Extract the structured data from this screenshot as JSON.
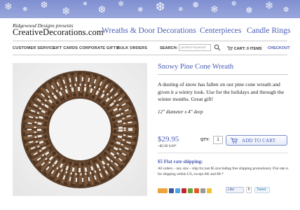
{
  "banner": {
    "color": "#8e9bd6"
  },
  "brand": {
    "tagline": "Ridgewood Designs presents",
    "name": "CreativeDecorations.com"
  },
  "main_nav": [
    {
      "label": "Wreaths & Door Decorations"
    },
    {
      "label": "Centerpieces"
    },
    {
      "label": "Candle Rings"
    }
  ],
  "sub_nav": [
    {
      "label": "CUSTOMER SERVICE"
    },
    {
      "label": "GIFT CARDS"
    },
    {
      "label": "CORPORATE GIFTS"
    },
    {
      "label": "BULK ORDERS"
    }
  ],
  "search": {
    "label": "SEARCH:",
    "placeholder": "product keyword",
    "icon": "search-icon"
  },
  "cart": {
    "label": "CART: 0 ITEMS",
    "checkout": "CHECKOUT",
    "icon": "cart-icon"
  },
  "product": {
    "title": "Snowy Pine Cone Wreath",
    "description": "A dusting of snow has fallen on our pine cone wreath and given it a wintry look. Use for the holidays and through the winter months. Great gift!",
    "dimensions": "12\" diameter x 4\" deep",
    "price": "$29.95",
    "shipping_cost": "+$5.00 S/H*",
    "qty_label": "QTY:",
    "qty_value": "1",
    "add_to_cart": "ADD TO CART",
    "flat_rate_title": "$5 Flat rate shipping:",
    "flat_rate_text": "All orders – any size – ship for just $5 (excluding free shipping promotions). Flat rate is for shipping within US, except AK and HI.*"
  },
  "social": {
    "fb_like": "Like",
    "fb_count": "5",
    "tweet": "Tweet"
  },
  "colors": {
    "accent": "#4a5db4",
    "text": "#222222"
  }
}
